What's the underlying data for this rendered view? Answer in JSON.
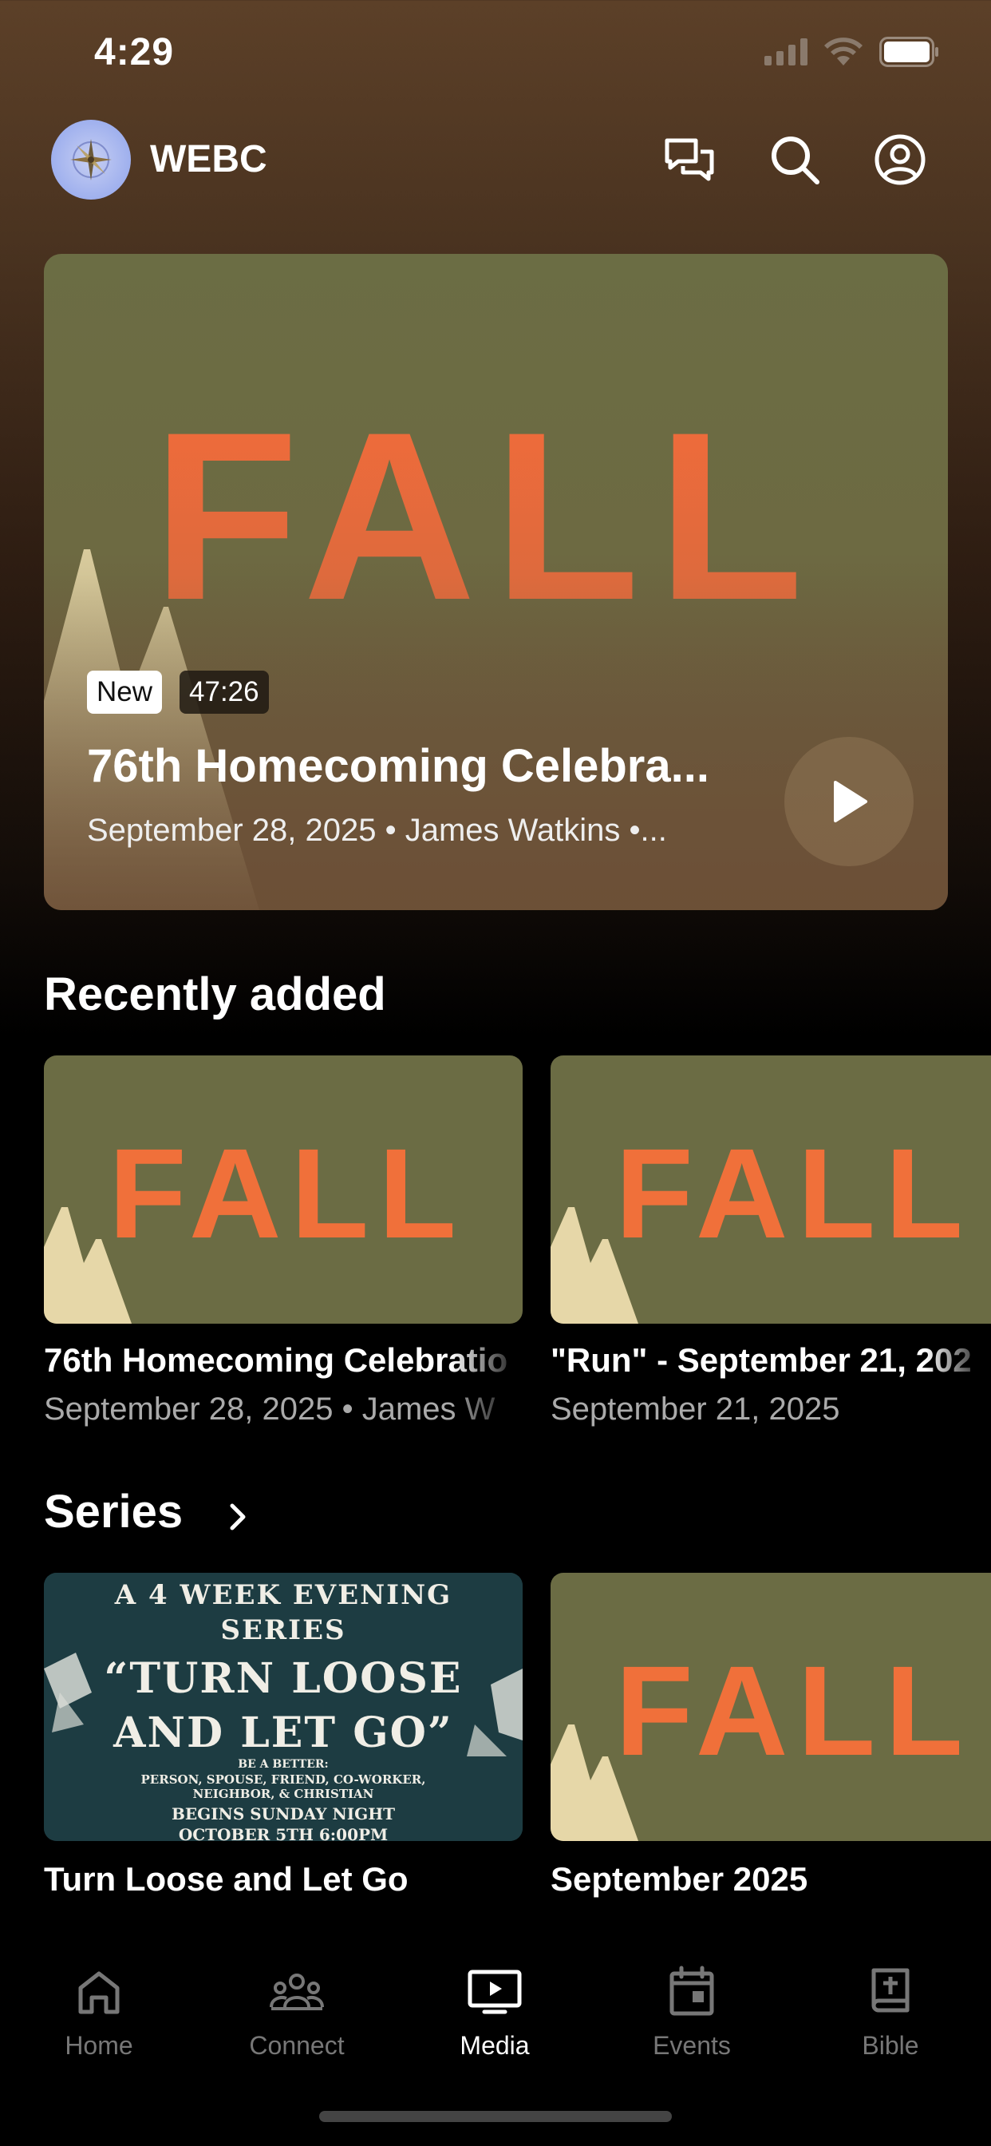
{
  "status_bar": {
    "time": "4:29"
  },
  "header": {
    "org_name": "WEBC",
    "icons": [
      "chat-icon",
      "search-icon",
      "profile-icon"
    ]
  },
  "hero": {
    "artwork_text": "FALL",
    "badge_new": "New",
    "duration": "47:26",
    "title": "76th Homecoming Celebra...",
    "meta": "September 28, 2025 • James Watkins •..."
  },
  "recently_added": {
    "title": "Recently added",
    "items": [
      {
        "artwork_text": "FALL",
        "title": "76th Homecoming Celebratio",
        "meta": "September 28, 2025 • James W"
      },
      {
        "artwork_text": "FALL",
        "title": "\"Run\" - September 21, 202",
        "meta": "September 21, 2025"
      }
    ]
  },
  "series": {
    "title": "Series",
    "items": [
      {
        "title": "Turn Loose and Let Go",
        "poster": {
          "line1": "A 4 WEEK EVENING",
          "line2": "SERIES",
          "line3": "“TURN LOOSE",
          "line4": "AND LET GO”",
          "line5": "BE A BETTER:",
          "line6": "PERSON, SPOUSE, FRIEND, CO-WORKER,",
          "line7": "NEIGHBOR, & CHRISTIAN",
          "line8": "BEGINS SUNDAY NIGHT",
          "line9": "OCTOBER 5TH 6:00PM"
        }
      },
      {
        "title": "September 2025",
        "artwork_text": "FALL"
      }
    ]
  },
  "tab_bar": {
    "tabs": [
      {
        "label": "Home",
        "icon": "home-icon",
        "active": false
      },
      {
        "label": "Connect",
        "icon": "people-icon",
        "active": false
      },
      {
        "label": "Media",
        "icon": "tv-play-icon",
        "active": true
      },
      {
        "label": "Events",
        "icon": "calendar-icon",
        "active": false
      },
      {
        "label": "Bible",
        "icon": "bible-icon",
        "active": false
      }
    ]
  },
  "colors": {
    "fall_orange": "#f0703a",
    "artwork_olive": "#6b6c44",
    "mountain_cream": "#e6d7a8",
    "poster_teal": "#1b3a40"
  }
}
